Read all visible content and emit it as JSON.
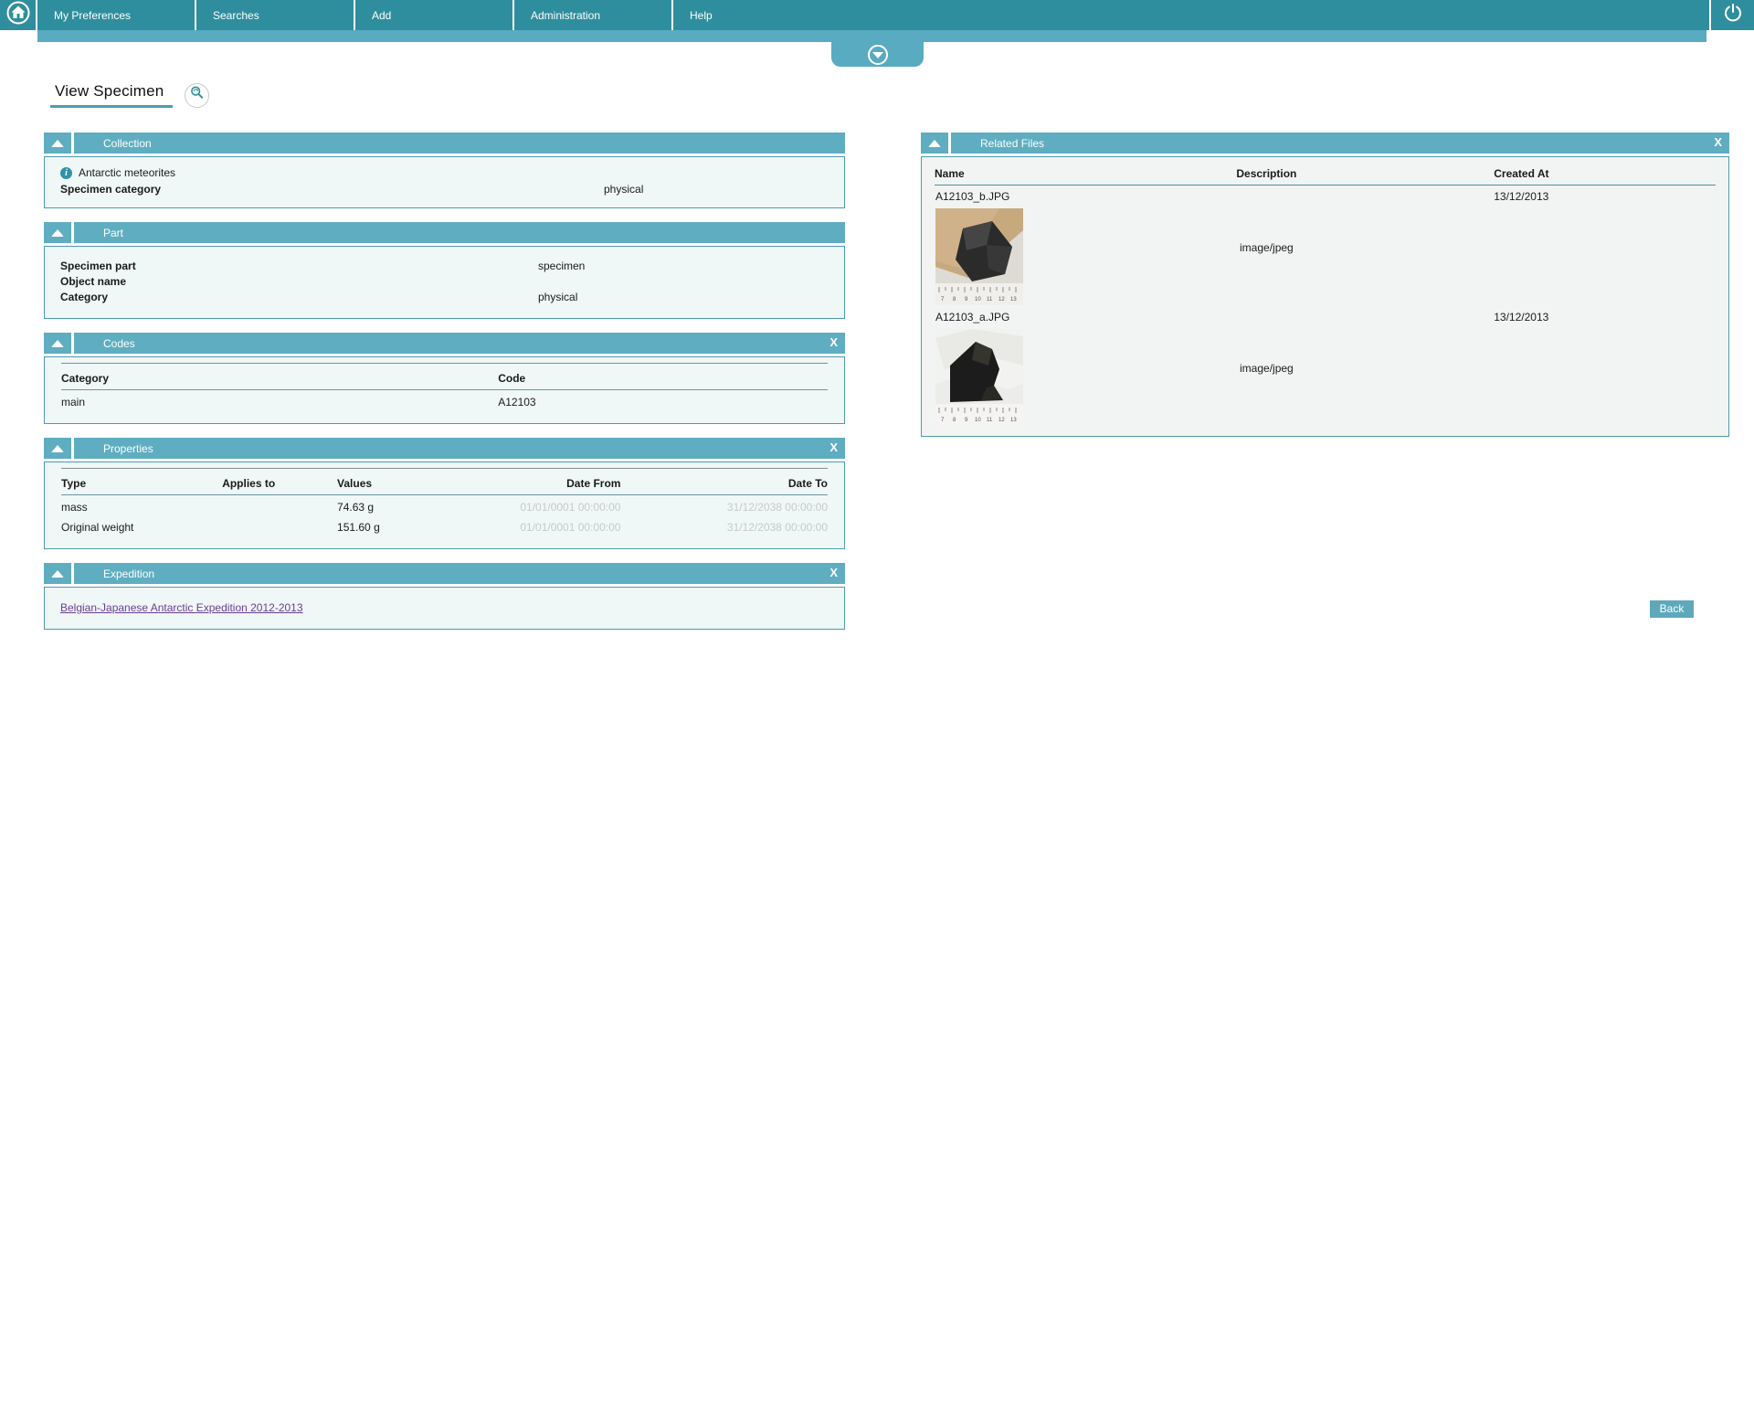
{
  "colors": {
    "accent": "#2f8e9d",
    "accent_light": "#5fadc0",
    "link_purple": "#6a3d91",
    "muted_date": "#c9c9c9"
  },
  "navbar": {
    "items": [
      "My Preferences",
      "Searches",
      "Add",
      "Administration",
      "Help"
    ]
  },
  "page": {
    "title": "View Specimen"
  },
  "ui": {
    "close_label": "X",
    "back_label": "Back"
  },
  "collection": {
    "title": "Collection",
    "info_text": "Antarctic meteorites",
    "label": "Specimen category",
    "value": "physical"
  },
  "part": {
    "title": "Part",
    "rows": [
      {
        "label": "Specimen part",
        "value": "specimen"
      },
      {
        "label": "Object name",
        "value": ""
      },
      {
        "label": "Category",
        "value": "physical"
      }
    ]
  },
  "codes": {
    "title": "Codes",
    "headers": [
      "Category",
      "Code"
    ],
    "rows": [
      {
        "category": "main",
        "code": "A12103"
      }
    ]
  },
  "properties": {
    "title": "Properties",
    "headers": [
      "Type",
      "Applies to",
      "Values",
      "Date From",
      "Date To"
    ],
    "rows": [
      {
        "type": "mass",
        "applies_to": "",
        "values": "74.63 g",
        "date_from": "01/01/0001 00:00:00",
        "date_to": "31/12/2038 00:00:00"
      },
      {
        "type": "Original weight",
        "applies_to": "",
        "values": "151.60 g",
        "date_from": "01/01/0001 00:00:00",
        "date_to": "31/12/2038 00:00:00"
      }
    ]
  },
  "expedition": {
    "title": "Expedition",
    "link": "Belgian-Japanese Antarctic Expedition 2012-2013"
  },
  "related_files": {
    "title": "Related Files",
    "headers": [
      "Name",
      "Description",
      "Created At"
    ],
    "files": [
      {
        "name": "A12103_b.JPG",
        "description": "image/jpeg",
        "created_at": "13/12/2013"
      },
      {
        "name": "A12103_a.JPG",
        "description": "image/jpeg",
        "created_at": "13/12/2013"
      }
    ]
  }
}
